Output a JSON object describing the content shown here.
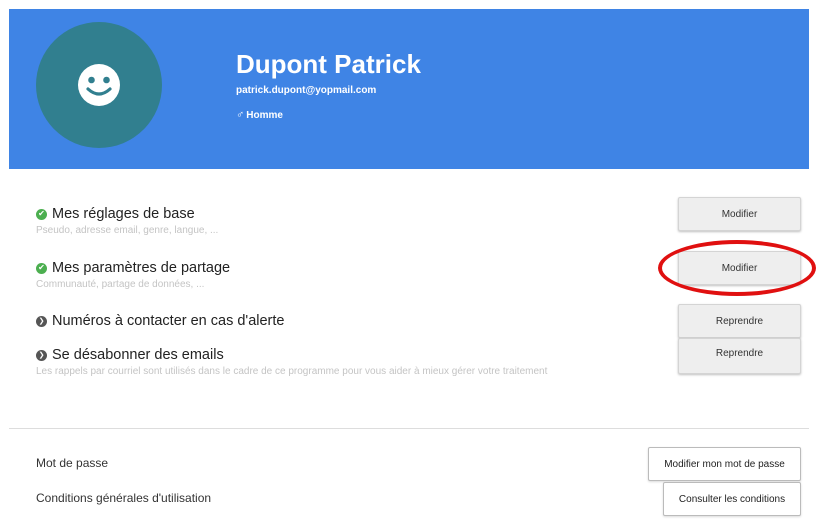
{
  "profile": {
    "name": "Dupont Patrick",
    "email": "patrick.dupont@yopmail.com",
    "gender_symbol": "♂",
    "gender_label": "Homme",
    "avatar_icon": "smiley-face-icon"
  },
  "settings": [
    {
      "status": "complete",
      "title": "Mes réglages de base",
      "description": "Pseudo, adresse email, genre, langue, ...",
      "button_label": "Modifier"
    },
    {
      "status": "complete",
      "title": "Mes paramètres de partage",
      "description": "Communauté, partage de données, ...",
      "button_label": "Modifier"
    },
    {
      "status": "pending",
      "title": "Numéros à contacter en cas d'alerte",
      "description": "",
      "button_label": "Reprendre"
    },
    {
      "status": "pending",
      "title": "Se désabonner des emails",
      "description": "Les rappels par courriel sont utilisés dans le cadre de ce programme pour vous aider à mieux gérer votre traitement",
      "button_label": "Reprendre"
    }
  ],
  "account": {
    "password_label": "Mot de passe",
    "password_button": "Modifier mon mot de passe",
    "terms_label": "Conditions générales d'utilisation",
    "terms_button": "Consulter les conditions"
  },
  "colors": {
    "header_bg": "#3f84e5",
    "avatar_bg": "#317f8f",
    "check_green": "#4caf50",
    "highlight_red": "#e01010"
  }
}
